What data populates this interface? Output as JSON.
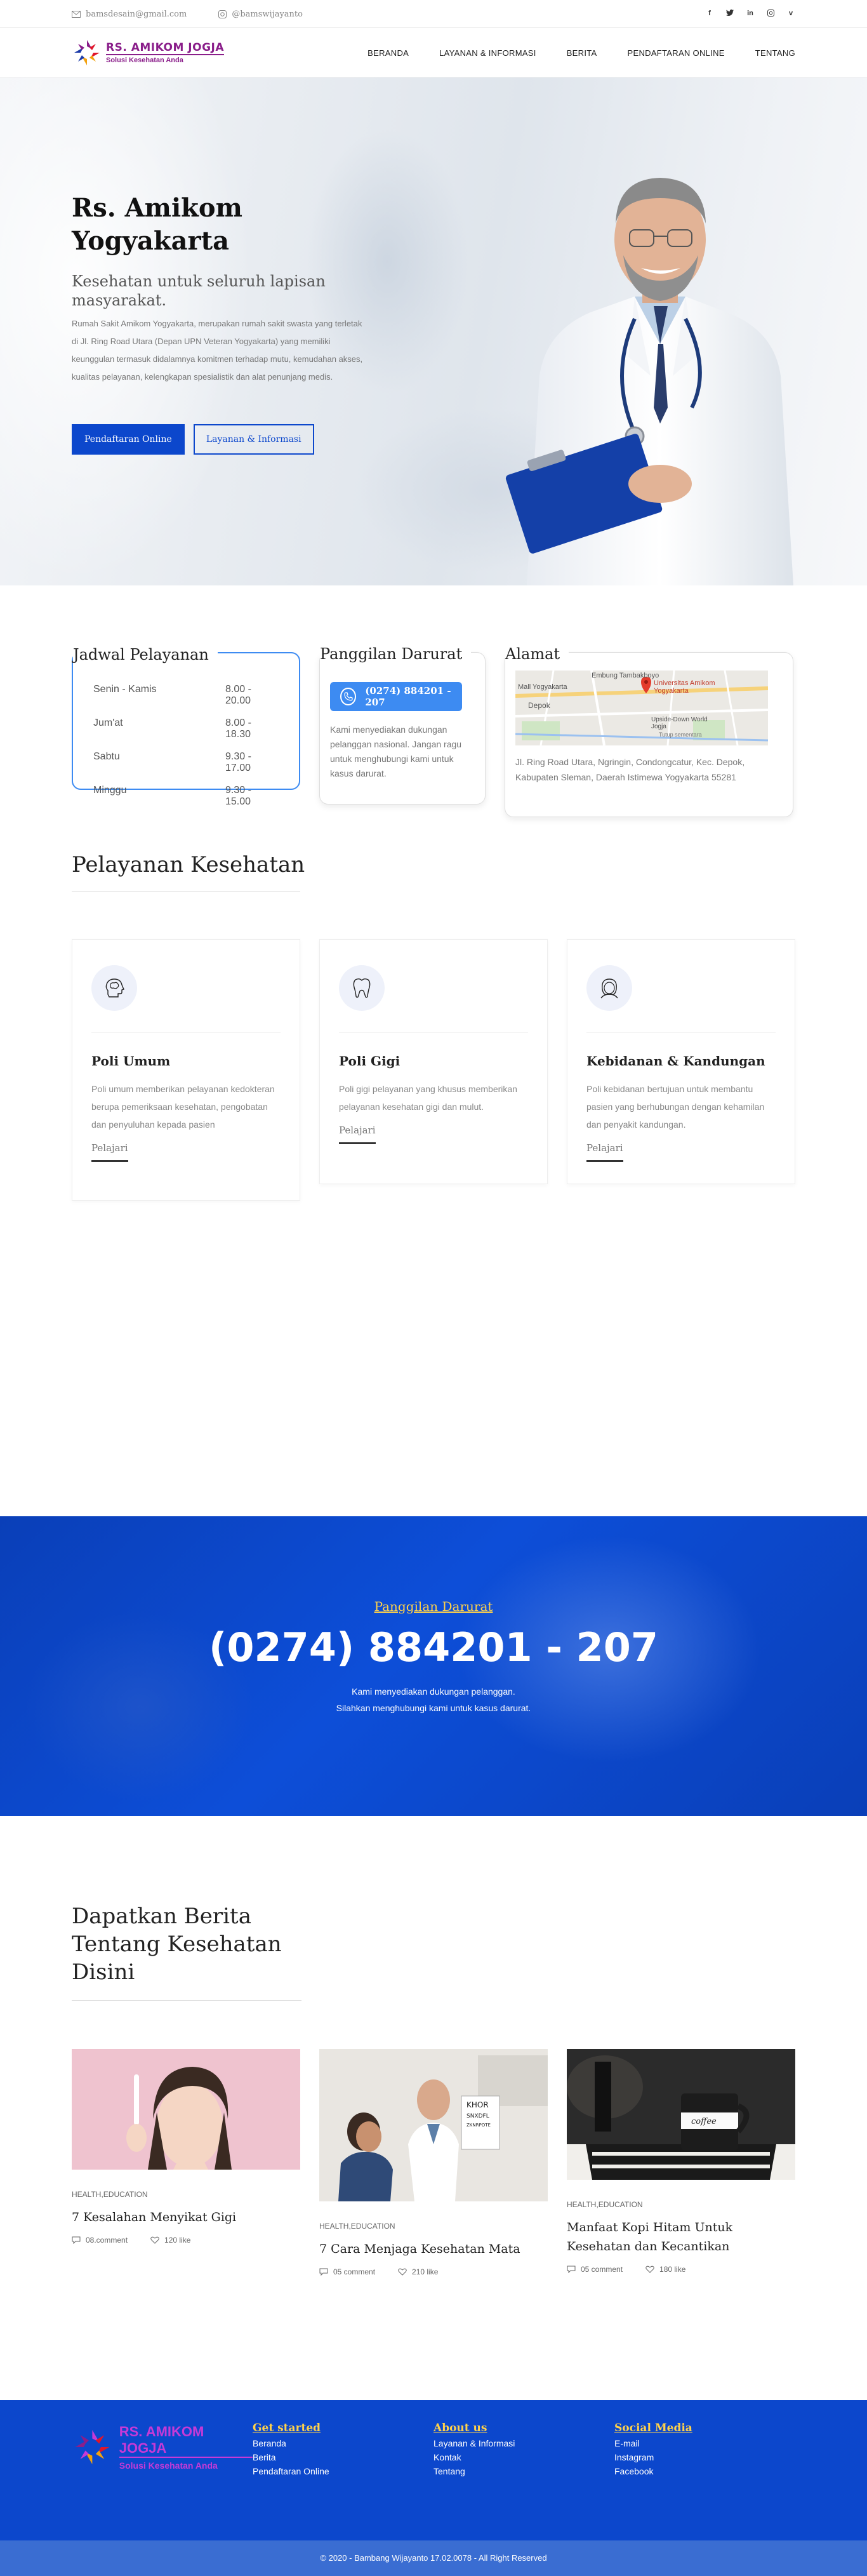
{
  "topbar": {
    "email": "bamsdesain@gmail.com",
    "instagram": "@bamswijayanto",
    "socials": [
      "facebook",
      "twitter",
      "linkedin",
      "instagram",
      "vimeo"
    ]
  },
  "brand": {
    "title": "RS. AMIKOM JOGJA",
    "subtitle": "Solusi Kesehatan Anda"
  },
  "nav": {
    "items": [
      "BERANDA",
      "LAYANAN & INFORMASI",
      "BERITA",
      "PENDAFTARAN ONLINE",
      "TENTANG"
    ]
  },
  "hero": {
    "title": "Rs. Amikom Yogyakarta",
    "subtitle": "Kesehatan untuk seluruh lapisan masyarakat.",
    "body": "Rumah Sakit Amikom Yogyakarta, merupakan rumah sakit swasta yang terletak di Jl. Ring Road Utara (Depan UPN Veteran Yogyakarta) yang memiliki keunggulan termasuk didalamnya komitmen terhadap mutu, kemudahan akses, kualitas pelayanan, kelengkapan spesialistik dan alat penunjang medis.",
    "primary_btn": "Pendaftaran Online",
    "secondary_btn": "Layanan & Informasi"
  },
  "schedule": {
    "title": "Jadwal Pelayanan",
    "rows": [
      {
        "day": "Senin - Kamis",
        "time": "8.00 - 20.00"
      },
      {
        "day": "Jum'at",
        "time": "8.00 - 18.30"
      },
      {
        "day": "Sabtu",
        "time": "9.30 - 17.00"
      },
      {
        "day": "Minggu",
        "time": "9.30 - 15.00"
      }
    ]
  },
  "emergency_card": {
    "title": "Panggilan Darurat",
    "phone": "(0274) 884201 - 207",
    "text": "Kami menyediakan dukungan pelanggan nasional. Jangan ragu untuk menghubungi kami untuk kasus darurat."
  },
  "address": {
    "title": "Alamat",
    "map_labels": [
      "Embung Tambakboyo",
      "Mall Yogyakarta",
      "Depok",
      "Universitas Amikom Yogyakarta",
      "Upside-Down World Jogja",
      "Tutup sementara"
    ],
    "text": "Jl. Ring Road Utara, Ngringin, Condongcatur, Kec. Depok, Kabupaten Sleman, Daerah Istimewa Yogyakarta 55281"
  },
  "services": {
    "title": "Pelayanan Kesehatan",
    "items": [
      {
        "icon": "brain-icon",
        "name": "Poli Umum",
        "desc": "Poli umum memberikan pelayanan kedokteran berupa pemeriksaan kesehatan, pengobatan dan penyuluhan kepada pasien",
        "link": "Pelajari"
      },
      {
        "icon": "tooth-icon",
        "name": "Poli Gigi",
        "desc": "Poli gigi pelayanan yang khusus memberikan pelayanan kesehatan gigi dan mulut.",
        "link": "Pelajari"
      },
      {
        "icon": "woman-icon",
        "name": "Kebidanan & Kandungan",
        "desc": "Poli kebidanan bertujuan untuk membantu pasien yang berhubungan dengan kehamilan dan penyakit kandungan.",
        "link": "Pelajari"
      }
    ]
  },
  "banner": {
    "kicker": "Panggilan Darurat",
    "phone": "(0274) 884201 - 207",
    "line1": "Kami menyediakan dukungan pelanggan.",
    "line2": "Silahkan menghubungi kami untuk kasus darurat."
  },
  "news": {
    "title": "Dapatkan Berita Tentang Kesehatan Disini",
    "items": [
      {
        "category": "HEALTH,EDUCATION",
        "title": "7 Kesalahan Menyikat Gigi",
        "comments": "08.comment",
        "likes": "120 like"
      },
      {
        "category": "HEALTH,EDUCATION",
        "title": "7 Cara Menjaga Kesehatan Mata",
        "comments": "05 comment",
        "likes": "210 like"
      },
      {
        "category": "HEALTH,EDUCATION",
        "title": "Manfaat Kopi Hitam Untuk Kesehatan dan Kecantikan",
        "comments": "05 comment",
        "likes": "180 like"
      }
    ]
  },
  "footer": {
    "brand_title": "RS. AMIKOM JOGJA",
    "brand_sub": "Solusi Kesehatan Anda",
    "cols": [
      {
        "title": "Get started",
        "links": [
          "Beranda",
          "Berita",
          "Pendaftaran Online"
        ]
      },
      {
        "title": "About us",
        "links": [
          "Layanan & Informasi",
          "Kontak",
          "Tentang"
        ]
      },
      {
        "title": "Social Media",
        "links": [
          "E-mail",
          "Instagram",
          "Facebook"
        ]
      }
    ],
    "copyright": "© 2020 - Bambang Wijayanto 17.02.0078 - All Right Reserved"
  },
  "colors": {
    "primary": "#0c47cc",
    "accent": "#3d8bf2",
    "gold": "#ffd24a",
    "brand": "#8a1e8a"
  }
}
